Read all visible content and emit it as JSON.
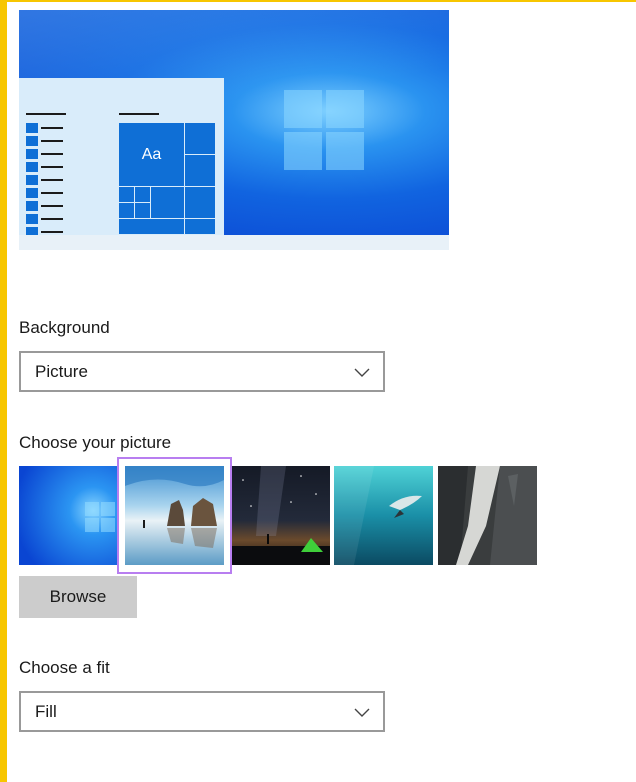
{
  "colors": {
    "accent_border": "#f7c600",
    "selection_border": "#b87ef0",
    "tile_blue": "#0f6fd6",
    "button_gray": "#cccccc"
  },
  "preview": {
    "tile_label": "Aa"
  },
  "background": {
    "label": "Background",
    "selected": "Picture"
  },
  "picture": {
    "label": "Choose your picture",
    "thumbnails": [
      {
        "name": "windows-light"
      },
      {
        "name": "beach-rocks",
        "selected": true
      },
      {
        "name": "night-sky-tent"
      },
      {
        "name": "underwater-swimmer"
      },
      {
        "name": "rock-waterfall"
      }
    ],
    "browse_label": "Browse"
  },
  "fit": {
    "label": "Choose a fit",
    "selected": "Fill"
  },
  "icons": {
    "dropdown": "chevron-down-icon"
  }
}
